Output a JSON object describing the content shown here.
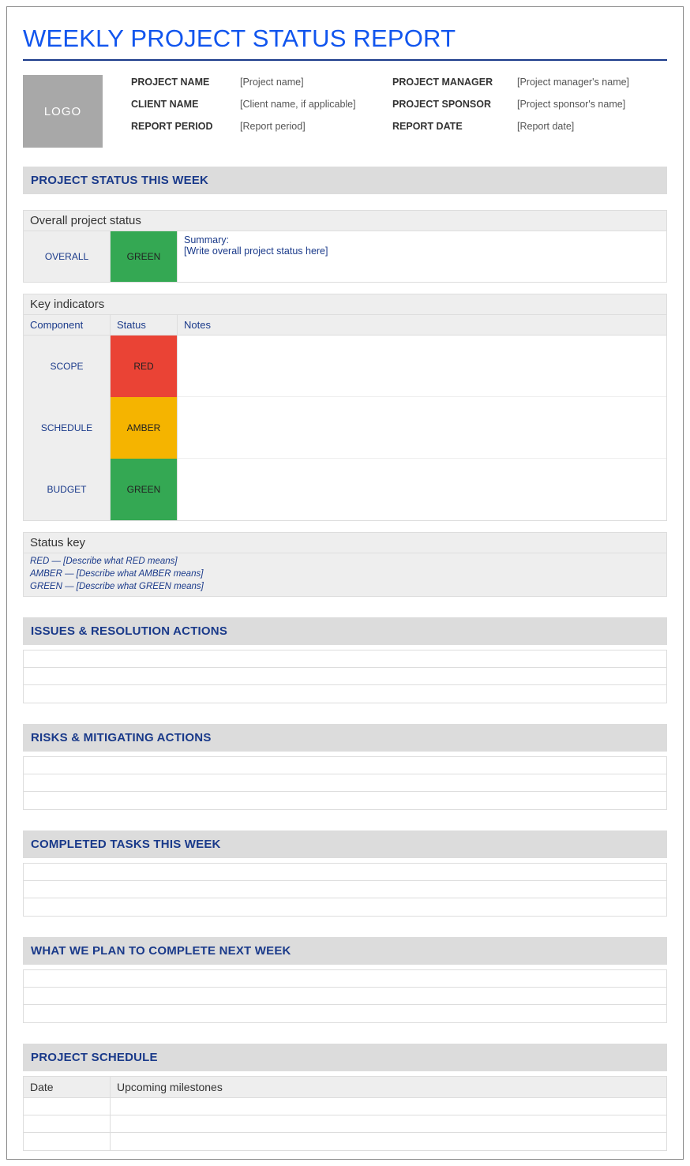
{
  "title": "WEEKLY PROJECT STATUS REPORT",
  "logo_text": "LOGO",
  "meta": {
    "project_name_label": "PROJECT NAME",
    "project_name": "[Project name]",
    "project_manager_label": "PROJECT MANAGER",
    "project_manager": "[Project manager's name]",
    "client_name_label": "CLIENT NAME",
    "client_name": "[Client name, if applicable]",
    "project_sponsor_label": "PROJECT SPONSOR",
    "project_sponsor": "[Project sponsor's name]",
    "report_period_label": "REPORT PERIOD",
    "report_period": "[Report period]",
    "report_date_label": "REPORT DATE",
    "report_date": "[Report date]"
  },
  "sections": {
    "status_this_week": "PROJECT STATUS THIS WEEK",
    "overall_sub": "Overall project status",
    "overall_label": "OVERALL",
    "overall_status": "GREEN",
    "summary_label": "Summary:",
    "summary_text": "[Write overall project status here]",
    "key_indicators_sub": "Key indicators",
    "ki_headers": {
      "component": "Component",
      "status": "Status",
      "notes": "Notes"
    },
    "ki": [
      {
        "component": "SCOPE",
        "status": "RED",
        "class": "red",
        "notes": ""
      },
      {
        "component": "SCHEDULE",
        "status": "AMBER",
        "class": "amber",
        "notes": ""
      },
      {
        "component": "BUDGET",
        "status": "GREEN",
        "class": "green",
        "notes": ""
      }
    ],
    "status_key_title": "Status key",
    "status_key": [
      "RED — [Describe what RED means]",
      "AMBER — [Describe what AMBER means]",
      "GREEN — [Describe what GREEN means]"
    ],
    "issues": "ISSUES & RESOLUTION ACTIONS",
    "risks": "RISKS & MITIGATING ACTIONS",
    "completed": "COMPLETED TASKS THIS WEEK",
    "next_week": "WHAT WE PLAN TO COMPLETE NEXT WEEK",
    "schedule": "PROJECT SCHEDULE",
    "schedule_headers": {
      "date": "Date",
      "milestones": "Upcoming milestones"
    }
  }
}
